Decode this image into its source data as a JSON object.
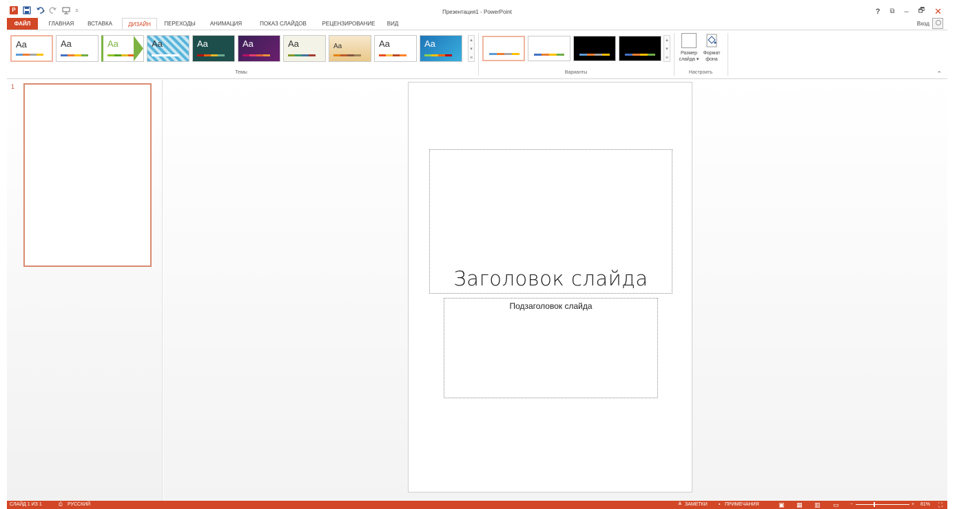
{
  "window": {
    "title": "Презентация1 - PowerPoint",
    "controls": [
      "?",
      "⧉",
      "–",
      "🗗",
      "✕"
    ]
  },
  "qat": {
    "icons": [
      "powerpoint-logo",
      "save-icon",
      "undo-icon",
      "redo-icon",
      "start-slideshow-icon",
      "customize-qat-icon"
    ],
    "logo_text": "P"
  },
  "tabs": [
    {
      "label": "ФАЙЛ"
    },
    {
      "label": "ГЛАВНАЯ"
    },
    {
      "label": "ВСТАВКА"
    },
    {
      "label": "ДИЗАЙН"
    },
    {
      "label": "ПЕРЕХОДЫ"
    },
    {
      "label": "АНИМАЦИЯ"
    },
    {
      "label": "ПОКАЗ СЛАЙДОВ"
    },
    {
      "label": "РЕЦЕНЗИРОВАНИЕ"
    },
    {
      "label": "ВИД"
    }
  ],
  "account": {
    "signin_label": "Вход"
  },
  "ribbon": {
    "themes_label": "Темы",
    "variants_label": "Варианты",
    "customize_label": "Настроить",
    "theme_tile_text": "Aa",
    "slide_size": {
      "line1": "Размер",
      "line2": "слайда ▾"
    },
    "format_bg": {
      "line1": "Формат",
      "line2": "фона"
    }
  },
  "colors": {
    "accent": "#d24726",
    "theme_bars": [
      "#d24726",
      "#f2b134",
      "#5b9bd5",
      "#70ad47"
    ]
  },
  "slides_panel": {
    "slide_number": "1"
  },
  "slide": {
    "title_placeholder": "Заголовок слайда",
    "subtitle_placeholder": "Подзаголовок слайда"
  },
  "status": {
    "slide_info": "СЛАЙД 1 ИЗ 1",
    "language": "РУССКИЙ",
    "notes": "ЗАМЕТКИ",
    "comments": "ПРИМЕЧАНИЯ",
    "zoom_minus": "−",
    "zoom_plus": "+",
    "zoom": "81%"
  }
}
